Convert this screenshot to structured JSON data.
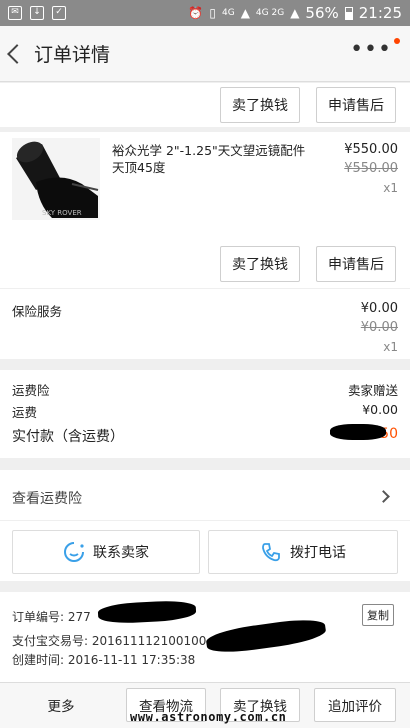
{
  "status_bar": {
    "battery": "56%",
    "time": "21:25",
    "net1": "4G",
    "net2": "4G 2G"
  },
  "nav": {
    "title": "订单详情"
  },
  "top_actions": {
    "sell": "卖了换钱",
    "after_sale": "申请售后"
  },
  "product": {
    "title": "裕众光学 2\"-1.25\"天文望远镜配件 天顶45度",
    "price": "¥550.00",
    "original_price": "¥550.00",
    "qty": "x1",
    "sell": "卖了换钱",
    "after_sale": "申请售后"
  },
  "insurance": {
    "label": "保险服务",
    "price": "¥0.00",
    "original_price": "¥0.00",
    "qty": "x1"
  },
  "shipping": {
    "freight_ins_label": "运费险",
    "freight_ins_value": "卖家赠送",
    "freight_label": "运费",
    "freight_value": "¥0.00",
    "paid_label": "实付款（含运费）",
    "paid_value": "¥.50"
  },
  "view_freight_ins": "查看运费险",
  "contact": {
    "seller": "联系卖家",
    "call": "拨打电话"
  },
  "order_info": {
    "order_no": "订单编号: 277",
    "alipay_no": "支付宝交易号: 201611112100100",
    "created": "创建时间:   2016-11-11 17:35:38",
    "copy": "复制"
  },
  "bottom": {
    "more": "更多",
    "logistics": "查看物流",
    "sell": "卖了换钱",
    "review": "追加评价"
  },
  "watermark": "www.astronomy.com.cn",
  "colors": {
    "accent": "#ff5000",
    "redact": "#000000"
  }
}
